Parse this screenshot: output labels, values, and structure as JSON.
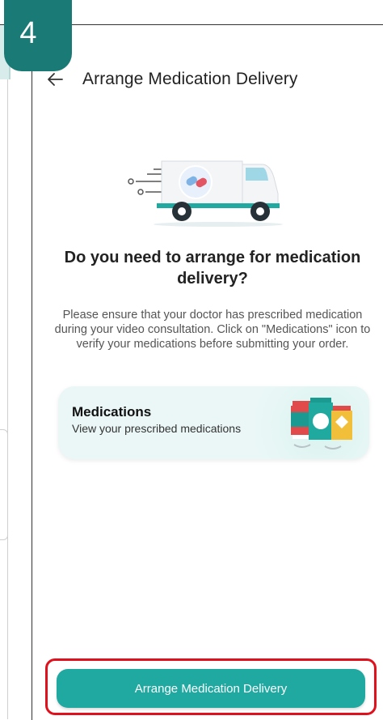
{
  "step_badge": "4",
  "header": {
    "title": "Arrange Medication Delivery",
    "back_icon": "arrow-left-icon"
  },
  "hero": {
    "icon": "delivery-van-icon"
  },
  "question": "Do you need to arrange for medication delivery?",
  "info": "Please ensure that your doctor has prescribed medication during your video consultation. Click on \"Medications\" icon to verify your medications before submitting your order.",
  "medications_card": {
    "title": "Medications",
    "subtitle": "View your prescribed medications",
    "icon": "medication-bottles-icon"
  },
  "cta": {
    "label": "Arrange Medication Delivery"
  },
  "colors": {
    "teal": "#1fa9a1",
    "badge": "#1a7a76",
    "highlight": "#e0101c"
  }
}
